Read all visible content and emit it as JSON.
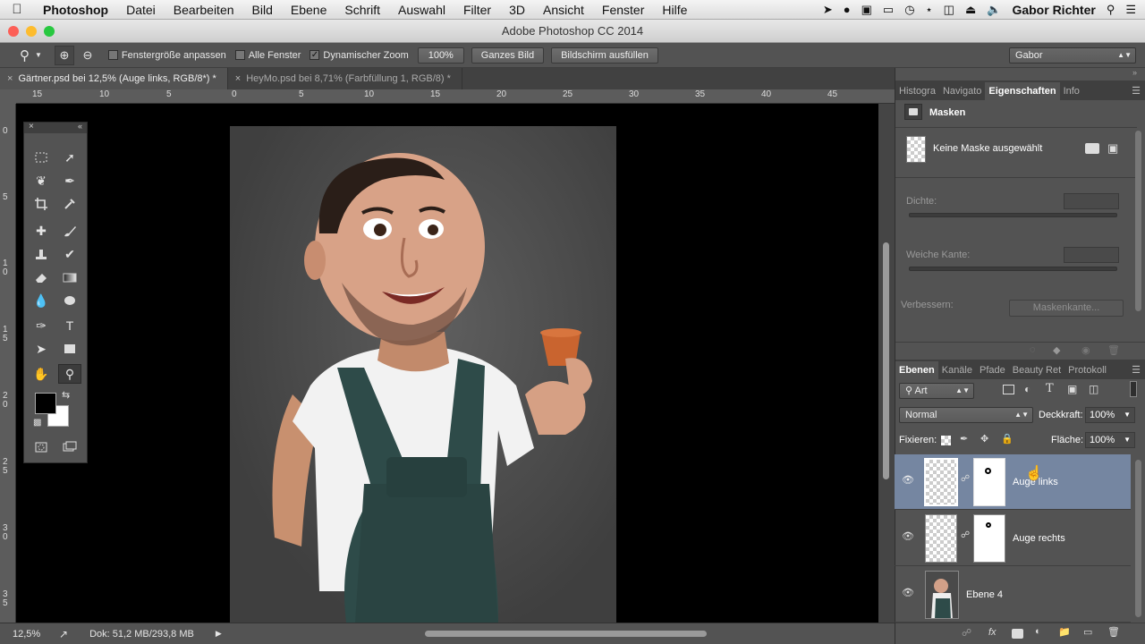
{
  "menubar": {
    "app": "Photoshop",
    "items": [
      "Datei",
      "Bearbeiten",
      "Bild",
      "Ebene",
      "Schrift",
      "Auswahl",
      "Filter",
      "3D",
      "Ansicht",
      "Fenster",
      "Hilfe"
    ],
    "user": "Gabor Richter"
  },
  "window": {
    "title": "Adobe Photoshop CC 2014"
  },
  "options": {
    "fit_window": "Fenstergröße anpassen",
    "all_windows": "Alle Fenster",
    "dynamic_zoom": "Dynamischer Zoom",
    "zoom_value": "100%",
    "whole_image": "Ganzes Bild",
    "fill_screen": "Bildschirm ausfüllen",
    "workspace": "Gabor"
  },
  "tabs": [
    {
      "label": "Gärtner.psd bei 12,5% (Auge links, RGB/8*) *",
      "active": true
    },
    {
      "label": "HeyMo.psd bei 8,71% (Farbfüllung 1, RGB/8) *",
      "active": false
    }
  ],
  "rulers": {
    "h": [
      "15",
      "10",
      "5",
      "0",
      "5",
      "10",
      "15",
      "20",
      "25",
      "30",
      "35",
      "40",
      "45"
    ],
    "v": [
      "0",
      "5",
      "1\n0",
      "1\n5",
      "2\n0",
      "2\n5",
      "3\n0",
      "3\n5"
    ]
  },
  "status": {
    "zoom": "12,5%",
    "doc": "Dok: 51,2 MB/293,8 MB"
  },
  "properties_panel": {
    "tabs": [
      "Histogra",
      "Navigato",
      "Eigenschaften",
      "Info"
    ],
    "title": "Masken",
    "mask_status": "Keine Maske ausgewählt",
    "density_label": "Dichte:",
    "feather_label": "Weiche Kante:",
    "refine_label": "Verbessern:",
    "refine_button": "Maskenkante..."
  },
  "layers_panel": {
    "tabs": [
      "Ebenen",
      "Kanäle",
      "Pfade",
      "Beauty Ret",
      "Protokoll"
    ],
    "filter": "Art",
    "blend_mode": "Normal",
    "opacity_label": "Deckkraft:",
    "opacity_value": "100%",
    "lock_label": "Fixieren:",
    "fill_label": "Fläche:",
    "fill_value": "100%",
    "layers": [
      {
        "name": "Auge links",
        "selected": true
      },
      {
        "name": "Auge rechts",
        "selected": false
      },
      {
        "name": "Ebene 4",
        "selected": false
      }
    ]
  },
  "colors": {
    "selected_layer": "#7586a1",
    "panel_bg": "#535353"
  }
}
